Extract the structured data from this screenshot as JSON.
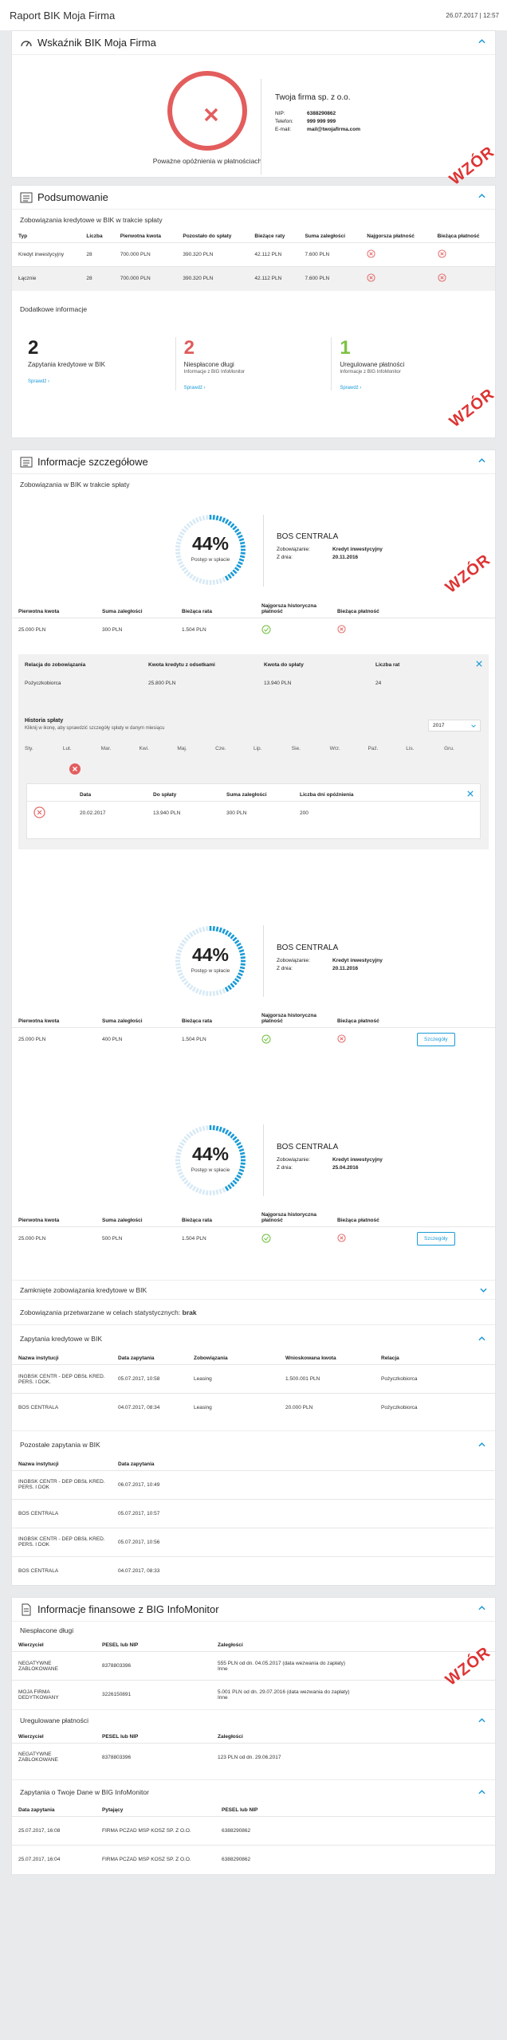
{
  "app": {
    "title": "Raport BIK Moja Firma",
    "datetime": "26.07.2017 | 12:57",
    "watermark": "WZÓR"
  },
  "indicator": {
    "title": "Wskaźnik BIK Moja Firma",
    "status": "Poważne opóźnienia w płatnościach",
    "company": "Twoja firma sp. z o.o.",
    "nip_label": "NIP:",
    "nip": "6388290862",
    "tel_label": "Telefon:",
    "tel": "999 999 999",
    "email_label": "E-mail:",
    "email": "mail@twojafirma.com"
  },
  "summary": {
    "title": "Podsumowanie",
    "sub": "Zobowiązania kredytowe w BIK w trakcie spłaty",
    "headers": [
      "Typ",
      "Liczba",
      "Pierwotna kwota",
      "Pozostało do spłaty",
      "Bieżące raty",
      "Suma zaległości",
      "Najgorsza płatność",
      "Bieżąca płatność"
    ],
    "rows": [
      [
        "Kredyt inwestycyjny",
        "28",
        "700.000 PLN",
        "390.320 PLN",
        "42.112 PLN",
        "7.600 PLN"
      ],
      [
        "Łącznie",
        "28",
        "700.000 PLN",
        "390.320 PLN",
        "42.112 PLN",
        "7.600 PLN"
      ]
    ],
    "extra": "Dodatkowe informacje",
    "stats": [
      {
        "n": "2",
        "l": "Zapytania kredytowe w BIK",
        "s": "",
        "a": "Sprawdź ›",
        "color": "#222"
      },
      {
        "n": "2",
        "l": "Niespłacone długi",
        "s": "Informacje z BIG InfoMonitor",
        "a": "Sprawdź ›",
        "color": "#e05b5b"
      },
      {
        "n": "1",
        "l": "Uregulowane płatności",
        "s": "Informacje z BIG InfoMonitor",
        "a": "Sprawdź ›",
        "color": "#7cc242"
      }
    ]
  },
  "details": {
    "title": "Informacje szczegółowe",
    "sub": "Zobowiązania w BIK w trakcie spłaty",
    "credits": [
      {
        "pct": "44%",
        "prog_label": "Postęp w spłacie",
        "progress": 0.44,
        "bank": "BOS CENTRALA",
        "obl_label": "Zobowiązanie:",
        "obl": "Kredyt inwestycyjny",
        "date_label": "Z dnia:",
        "date": "20.11.2016",
        "row": [
          "25.000 PLN",
          "300 PLN",
          "1.504 PLN"
        ]
      },
      {
        "pct": "44%",
        "prog_label": "Postęp w spłacie",
        "progress": 0.44,
        "bank": "BOS CENTRALA",
        "obl_label": "Zobowiązanie:",
        "obl": "Kredyt inwestycyjny",
        "date_label": "Z dnia:",
        "date": "20.11.2016",
        "row": [
          "25.000 PLN",
          "400 PLN",
          "1.504 PLN"
        ],
        "btn": "Szczegóły"
      },
      {
        "pct": "44%",
        "prog_label": "Postęp w spłacie",
        "progress": 0.44,
        "bank": "BOS CENTRALA",
        "obl_label": "Zobowiązanie:",
        "obl": "Kredyt inwestycyjny",
        "date_label": "Z dnia:",
        "date": "25.04.2016",
        "row": [
          "25.000 PLN",
          "500 PLN",
          "1.504 PLN"
        ],
        "btn": "Szczegóły"
      }
    ],
    "credit_headers": [
      "Pierwotna kwota",
      "Suma zaległości",
      "Bieżąca rata",
      "Najgorsza historyczna płatność",
      "Bieżąca płatność"
    ],
    "rel_headers": [
      "Relacja do zobowiązania",
      "Kwota kredytu z odsetkami",
      "Kwota do spłaty",
      "Liczba rat"
    ],
    "rel_row": [
      "Pożyczkobiorca",
      "25.800 PLN",
      "13.940 PLN",
      "24"
    ],
    "history_title": "Historia spłaty",
    "history_hint": "Kliknij w ikonę, aby sprawdzić szczegóły spłaty w danym miesiącu",
    "year": "2017",
    "months": [
      "Sty.",
      "Lut.",
      "Mar.",
      "Kwi.",
      "Maj.",
      "Cze.",
      "Lip.",
      "Sie.",
      "Wrz.",
      "Paź.",
      "Lis.",
      "Gru."
    ],
    "hist_headers": [
      "Data",
      "Do spłaty",
      "Suma zaległości",
      "Liczba dni opóźnienia"
    ],
    "hist_row": [
      "20.02.2017",
      "13.940 PLN",
      "300 PLN",
      "200"
    ],
    "closed": "Zamknięte zobowiązania kredytowe w BIK",
    "stat_label": "Zobowiązania przetwarzane w celach statystycznych:",
    "stat_value": "brak",
    "queries_title": "Zapytania kredytowe w BIK",
    "queries_headers": [
      "Nazwa instytucji",
      "Data zapytania",
      "Zobowiązania",
      "Wnioskowana kwota",
      "Relacja"
    ],
    "queries": [
      [
        "INGBSK CENTR - DEP OBSŁ KRED. PERS. I DOK.",
        "05.07.2017, 10:58",
        "Leasing",
        "1.500.001 PLN",
        "Pożyczkobiorca"
      ],
      [
        "BOS CENTRALA",
        "04.07.2017, 08:34",
        "Leasing",
        "20.000 PLN",
        "Pożyczkobiorca"
      ]
    ],
    "other_title": "Pozostałe zapytania w BIK",
    "other_headers": [
      "Nazwa instytucji",
      "Data zapytania"
    ],
    "other": [
      [
        "INGBSK CENTR - DEP OBSŁ KRED. PERS. I DOK",
        "06.07.2017, 10:49"
      ],
      [
        "BOS CENTRALA",
        "05.07.2017, 10:57"
      ],
      [
        "INGBSK CENTR - DEP OBSŁ KRED. PERS. I DOK",
        "05.07.2017, 10:56"
      ],
      [
        "BOS CENTRALA",
        "04.07.2017, 08:33"
      ]
    ]
  },
  "big": {
    "title": "Informacje finansowe z BIG InfoMonitor",
    "unpaid_title": "Niespłacone długi",
    "unpaid_headers": [
      "Wierzyciel",
      "PESEL lub NIP",
      "Zaległości"
    ],
    "unpaid": [
      [
        "NEGATYWNE ZABLOKOWANE",
        "8378803396",
        "555 PLN od dn. 04.05.2017 (data wezwania do zapłaty)",
        "Inne"
      ],
      [
        "MOJA FIRMA DEDYTKOWANY",
        "3226150891",
        "5.001 PLN od dn. 29.07.2016 (data wezwania do zapłaty)",
        "Inne"
      ]
    ],
    "paid_title": "Uregulowane płatności",
    "paid": [
      [
        "NEGATYWNE ZABLOKOWANE",
        "8378803396",
        "123 PLN od dn. 29.06.2017"
      ]
    ],
    "q_title": "Zapytania o Twoje Dane w BIG InfoMonitor",
    "q_headers": [
      "Data zapytania",
      "Pytający",
      "PESEL lub NIP"
    ],
    "q": [
      [
        "25.07.2017, 16:08",
        "FIRMA PCZAD MSP KOSZ SP. Z O.O.",
        "6388290862"
      ],
      [
        "25.07.2017, 16:04",
        "FIRMA PCZAD MSP KOSZ SP. Z O.O.",
        "6388290862"
      ]
    ]
  }
}
